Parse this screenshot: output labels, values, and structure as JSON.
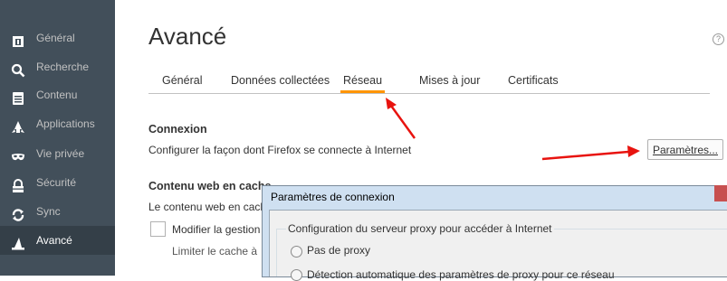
{
  "sidebar": {
    "items": [
      {
        "label": "Général",
        "icon": "general-icon",
        "active": false
      },
      {
        "label": "Recherche",
        "icon": "search-icon",
        "active": false
      },
      {
        "label": "Contenu",
        "icon": "document-icon",
        "active": false
      },
      {
        "label": "Applications",
        "icon": "rocket-icon",
        "active": false
      },
      {
        "label": "Vie privée",
        "icon": "mask-icon",
        "active": false
      },
      {
        "label": "Sécurité",
        "icon": "lock-icon",
        "active": false
      },
      {
        "label": "Sync",
        "icon": "sync-icon",
        "active": false
      },
      {
        "label": "Avancé",
        "icon": "wizard-hat-icon",
        "active": true
      }
    ]
  },
  "main": {
    "title": "Avancé",
    "help_label": "?",
    "tabs": [
      "Général",
      "Données collectées",
      "Réseau",
      "Mises à jour",
      "Certificats"
    ],
    "active_tab": "Réseau",
    "connexion": {
      "title": "Connexion",
      "description": "Configurer la façon dont Firefox se connecte à Internet",
      "button_label": "Paramètres..."
    },
    "cache": {
      "title": "Contenu web en cache",
      "description": "Le contenu web en cache",
      "override_label": "Modifier la gestion",
      "limit_label": "Limiter le cache à"
    }
  },
  "dialog": {
    "title": "Paramètres de connexion",
    "group_label": "Configuration du serveur proxy pour accéder à Internet",
    "options": [
      "Pas de proxy",
      "Détection automatique des paramètres de proxy pour ce réseau"
    ]
  },
  "colors": {
    "sidebar_bg": "#424f5a",
    "sidebar_active": "#343f48",
    "tab_accent": "#ff9500",
    "arrow": "#e8130f"
  }
}
